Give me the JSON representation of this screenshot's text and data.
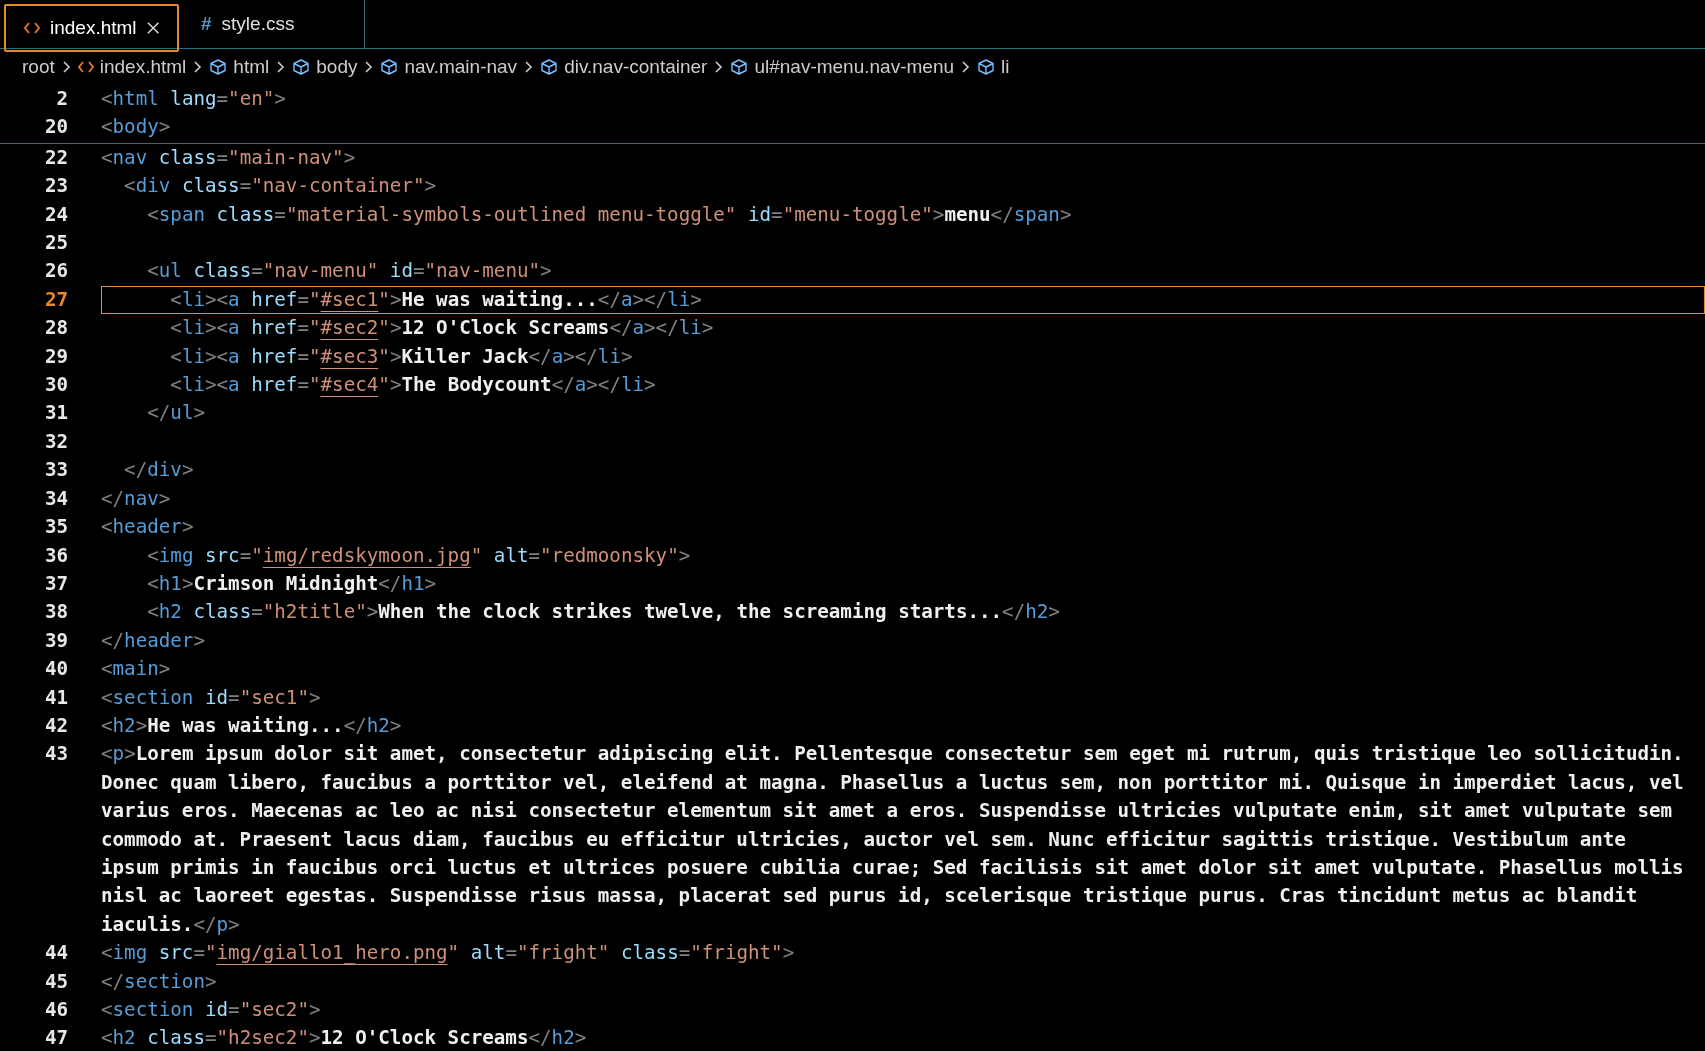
{
  "tabs": [
    {
      "label": "index.html",
      "kind": "html",
      "selected": true,
      "closable": true
    },
    {
      "label": "style.css",
      "kind": "css",
      "glyph": "#",
      "selected": false,
      "closable": false
    }
  ],
  "breadcrumb": [
    {
      "label": "root",
      "kind": "plain"
    },
    {
      "label": "index.html",
      "kind": "file"
    },
    {
      "label": "html",
      "kind": "symbol"
    },
    {
      "label": "body",
      "kind": "symbol"
    },
    {
      "label": "nav.main-nav",
      "kind": "symbol"
    },
    {
      "label": "div.nav-container",
      "kind": "symbol"
    },
    {
      "label": "ul#nav-menu.nav-menu",
      "kind": "symbol"
    },
    {
      "label": "li",
      "kind": "symbol"
    }
  ],
  "sticky_lines": [
    {
      "number": "2",
      "current": false,
      "tokens": [
        {
          "kind": "punct",
          "text": "<"
        },
        {
          "kind": "tag",
          "text": "html"
        },
        {
          "kind": "attr",
          "text": " lang"
        },
        {
          "kind": "punct",
          "text": "="
        },
        {
          "kind": "string",
          "text": "\"en\""
        },
        {
          "kind": "punct",
          "text": ">"
        }
      ]
    },
    {
      "number": "20",
      "current": false,
      "tokens": [
        {
          "kind": "punct",
          "text": "<"
        },
        {
          "kind": "tag",
          "text": "body"
        },
        {
          "kind": "punct",
          "text": ">"
        }
      ]
    }
  ],
  "lines": [
    {
      "number": "22",
      "current": false,
      "tokens": [
        {
          "kind": "punct",
          "text": "<"
        },
        {
          "kind": "tag",
          "text": "nav"
        },
        {
          "kind": "attr",
          "text": " class"
        },
        {
          "kind": "punct",
          "text": "="
        },
        {
          "kind": "string",
          "text": "\"main-nav\""
        },
        {
          "kind": "punct",
          "text": ">"
        }
      ]
    },
    {
      "number": "23",
      "current": false,
      "tokens": [
        {
          "kind": "punct",
          "text": "  <"
        },
        {
          "kind": "tag",
          "text": "div"
        },
        {
          "kind": "attr",
          "text": " class"
        },
        {
          "kind": "punct",
          "text": "="
        },
        {
          "kind": "string",
          "text": "\"nav-container\""
        },
        {
          "kind": "punct",
          "text": ">"
        }
      ]
    },
    {
      "number": "24",
      "current": false,
      "tokens": [
        {
          "kind": "punct",
          "text": "    <"
        },
        {
          "kind": "tag",
          "text": "span"
        },
        {
          "kind": "attr",
          "text": " class"
        },
        {
          "kind": "punct",
          "text": "="
        },
        {
          "kind": "string",
          "text": "\"material-symbols-outlined menu-toggle\""
        },
        {
          "kind": "attr",
          "text": " id"
        },
        {
          "kind": "punct",
          "text": "="
        },
        {
          "kind": "string",
          "text": "\"menu-toggle\""
        },
        {
          "kind": "punct",
          "text": ">"
        },
        {
          "kind": "text",
          "text": "menu"
        },
        {
          "kind": "punct",
          "text": "</"
        },
        {
          "kind": "tag",
          "text": "span"
        },
        {
          "kind": "punct",
          "text": ">"
        }
      ]
    },
    {
      "number": "25",
      "current": false
    },
    {
      "number": "26",
      "current": false,
      "tokens": [
        {
          "kind": "punct",
          "text": "    <"
        },
        {
          "kind": "tag",
          "text": "ul"
        },
        {
          "kind": "attr",
          "text": " class"
        },
        {
          "kind": "punct",
          "text": "="
        },
        {
          "kind": "string",
          "text": "\"nav-menu\""
        },
        {
          "kind": "attr",
          "text": " id"
        },
        {
          "kind": "punct",
          "text": "="
        },
        {
          "kind": "string",
          "text": "\"nav-menu\""
        },
        {
          "kind": "punct",
          "text": ">"
        }
      ]
    },
    {
      "number": "27",
      "current": true,
      "tokens": [
        {
          "kind": "punct",
          "text": "      <"
        },
        {
          "kind": "tag",
          "text": "li"
        },
        {
          "kind": "punct",
          "text": "><"
        },
        {
          "kind": "tag",
          "text": "a"
        },
        {
          "kind": "attr",
          "text": " href"
        },
        {
          "kind": "punct",
          "text": "="
        },
        {
          "kind": "string",
          "text": "\""
        },
        {
          "kind": "link",
          "text": "#sec1"
        },
        {
          "kind": "string",
          "text": "\""
        },
        {
          "kind": "punct",
          "text": ">"
        },
        {
          "kind": "text",
          "text": "He was waiting..."
        },
        {
          "kind": "punct",
          "text": "</"
        },
        {
          "kind": "tag",
          "text": "a"
        },
        {
          "kind": "punct",
          "text": "></"
        },
        {
          "kind": "tag",
          "text": "li"
        },
        {
          "kind": "punct",
          "text": ">"
        }
      ]
    },
    {
      "number": "28",
      "current": false,
      "tokens": [
        {
          "kind": "punct",
          "text": "      <"
        },
        {
          "kind": "tag",
          "text": "li"
        },
        {
          "kind": "punct",
          "text": "><"
        },
        {
          "kind": "tag",
          "text": "a"
        },
        {
          "kind": "attr",
          "text": " href"
        },
        {
          "kind": "punct",
          "text": "="
        },
        {
          "kind": "string",
          "text": "\""
        },
        {
          "kind": "link",
          "text": "#sec2"
        },
        {
          "kind": "string",
          "text": "\""
        },
        {
          "kind": "punct",
          "text": ">"
        },
        {
          "kind": "text",
          "text": "12 O'Clock Screams"
        },
        {
          "kind": "punct",
          "text": "</"
        },
        {
          "kind": "tag",
          "text": "a"
        },
        {
          "kind": "punct",
          "text": "></"
        },
        {
          "kind": "tag",
          "text": "li"
        },
        {
          "kind": "punct",
          "text": ">"
        }
      ]
    },
    {
      "number": "29",
      "current": false,
      "tokens": [
        {
          "kind": "punct",
          "text": "      <"
        },
        {
          "kind": "tag",
          "text": "li"
        },
        {
          "kind": "punct",
          "text": "><"
        },
        {
          "kind": "tag",
          "text": "a"
        },
        {
          "kind": "attr",
          "text": " href"
        },
        {
          "kind": "punct",
          "text": "="
        },
        {
          "kind": "string",
          "text": "\""
        },
        {
          "kind": "link",
          "text": "#sec3"
        },
        {
          "kind": "string",
          "text": "\""
        },
        {
          "kind": "punct",
          "text": ">"
        },
        {
          "kind": "text",
          "text": "Killer Jack"
        },
        {
          "kind": "punct",
          "text": "</"
        },
        {
          "kind": "tag",
          "text": "a"
        },
        {
          "kind": "punct",
          "text": "></"
        },
        {
          "kind": "tag",
          "text": "li"
        },
        {
          "kind": "punct",
          "text": ">"
        }
      ]
    },
    {
      "number": "30",
      "current": false,
      "tokens": [
        {
          "kind": "punct",
          "text": "      <"
        },
        {
          "kind": "tag",
          "text": "li"
        },
        {
          "kind": "punct",
          "text": "><"
        },
        {
          "kind": "tag",
          "text": "a"
        },
        {
          "kind": "attr",
          "text": " href"
        },
        {
          "kind": "punct",
          "text": "="
        },
        {
          "kind": "string",
          "text": "\""
        },
        {
          "kind": "link",
          "text": "#sec4"
        },
        {
          "kind": "string",
          "text": "\""
        },
        {
          "kind": "punct",
          "text": ">"
        },
        {
          "kind": "text",
          "text": "The Bodycount"
        },
        {
          "kind": "punct",
          "text": "</"
        },
        {
          "kind": "tag",
          "text": "a"
        },
        {
          "kind": "punct",
          "text": "></"
        },
        {
          "kind": "tag",
          "text": "li"
        },
        {
          "kind": "punct",
          "text": ">"
        }
      ]
    },
    {
      "number": "31",
      "current": false,
      "tokens": [
        {
          "kind": "punct",
          "text": "    </"
        },
        {
          "kind": "tag",
          "text": "ul"
        },
        {
          "kind": "punct",
          "text": ">"
        }
      ]
    },
    {
      "number": "32",
      "current": false
    },
    {
      "number": "33",
      "current": false,
      "tokens": [
        {
          "kind": "punct",
          "text": "  </"
        },
        {
          "kind": "tag",
          "text": "div"
        },
        {
          "kind": "punct",
          "text": ">"
        }
      ]
    },
    {
      "number": "34",
      "current": false,
      "tokens": [
        {
          "kind": "punct",
          "text": "</"
        },
        {
          "kind": "tag",
          "text": "nav"
        },
        {
          "kind": "punct",
          "text": ">"
        }
      ]
    },
    {
      "number": "35",
      "current": false,
      "tokens": [
        {
          "kind": "punct",
          "text": "<"
        },
        {
          "kind": "tag",
          "text": "header"
        },
        {
          "kind": "punct",
          "text": ">"
        }
      ]
    },
    {
      "number": "36",
      "current": false,
      "tokens": [
        {
          "kind": "punct",
          "text": "    <"
        },
        {
          "kind": "tag",
          "text": "img"
        },
        {
          "kind": "attr",
          "text": " src"
        },
        {
          "kind": "punct",
          "text": "="
        },
        {
          "kind": "string",
          "text": "\""
        },
        {
          "kind": "link",
          "text": "img/redskymoon.jpg"
        },
        {
          "kind": "string",
          "text": "\""
        },
        {
          "kind": "attr",
          "text": " alt"
        },
        {
          "kind": "punct",
          "text": "="
        },
        {
          "kind": "string",
          "text": "\"redmoonsky\""
        },
        {
          "kind": "punct",
          "text": ">"
        }
      ]
    },
    {
      "number": "37",
      "current": false,
      "tokens": [
        {
          "kind": "punct",
          "text": "    <"
        },
        {
          "kind": "tag",
          "text": "h1"
        },
        {
          "kind": "punct",
          "text": ">"
        },
        {
          "kind": "text",
          "text": "Crimson Midnight"
        },
        {
          "kind": "punct",
          "text": "</"
        },
        {
          "kind": "tag",
          "text": "h1"
        },
        {
          "kind": "punct",
          "text": ">"
        }
      ]
    },
    {
      "number": "38",
      "current": false,
      "tokens": [
        {
          "kind": "punct",
          "text": "    <"
        },
        {
          "kind": "tag",
          "text": "h2"
        },
        {
          "kind": "attr",
          "text": " class"
        },
        {
          "kind": "punct",
          "text": "="
        },
        {
          "kind": "string",
          "text": "\"h2title\""
        },
        {
          "kind": "punct",
          "text": ">"
        },
        {
          "kind": "text",
          "text": "When the clock strikes twelve, the screaming starts..."
        },
        {
          "kind": "punct",
          "text": "</"
        },
        {
          "kind": "tag",
          "text": "h2"
        },
        {
          "kind": "punct",
          "text": ">"
        }
      ]
    },
    {
      "number": "39",
      "current": false,
      "tokens": [
        {
          "kind": "punct",
          "text": "</"
        },
        {
          "kind": "tag",
          "text": "header"
        },
        {
          "kind": "punct",
          "text": ">"
        }
      ]
    },
    {
      "number": "40",
      "current": false,
      "tokens": [
        {
          "kind": "punct",
          "text": "<"
        },
        {
          "kind": "tag",
          "text": "main"
        },
        {
          "kind": "punct",
          "text": ">"
        }
      ]
    },
    {
      "number": "41",
      "current": false,
      "tokens": [
        {
          "kind": "punct",
          "text": "<"
        },
        {
          "kind": "tag",
          "text": "section"
        },
        {
          "kind": "attr",
          "text": " id"
        },
        {
          "kind": "punct",
          "text": "="
        },
        {
          "kind": "string",
          "text": "\"sec1\""
        },
        {
          "kind": "punct",
          "text": ">"
        }
      ]
    },
    {
      "number": "42",
      "current": false,
      "tokens": [
        {
          "kind": "punct",
          "text": "<"
        },
        {
          "kind": "tag",
          "text": "h2"
        },
        {
          "kind": "punct",
          "text": ">"
        },
        {
          "kind": "text",
          "text": "He was waiting..."
        },
        {
          "kind": "punct",
          "text": "</"
        },
        {
          "kind": "tag",
          "text": "h2"
        },
        {
          "kind": "punct",
          "text": ">"
        }
      ]
    },
    {
      "number": "43",
      "current": false,
      "tokens": [
        {
          "kind": "punct",
          "text": "<"
        },
        {
          "kind": "tag",
          "text": "p"
        },
        {
          "kind": "punct",
          "text": ">"
        },
        {
          "kind": "text",
          "text": "Lorem ipsum dolor sit amet, consectetur adipiscing elit. Pellentesque consectetur sem eget mi rutrum, quis tristique leo sollicitudin. Donec quam libero, faucibus a porttitor vel, eleifend at magna. Phasellus a luctus sem, non porttitor mi. Quisque in imperdiet lacus, vel varius eros. Maecenas ac leo ac nisi consectetur elementum sit amet a eros. Suspendisse ultricies vulputate enim, sit amet vulputate sem commodo at. Praesent lacus diam, faucibus eu efficitur ultricies, auctor vel sem. Nunc efficitur sagittis tristique. Vestibulum ante ipsum primis in faucibus orci luctus et ultrices posuere cubilia curae; Sed facilisis sit amet dolor sit amet vulputate. Phasellus mollis nisl ac laoreet egestas. Suspendisse risus massa, placerat sed purus id, scelerisque tristique purus. Cras tincidunt metus ac blandit iaculis."
        },
        {
          "kind": "punct",
          "text": "</"
        },
        {
          "kind": "tag",
          "text": "p"
        },
        {
          "kind": "punct",
          "text": ">"
        }
      ]
    },
    {
      "number": "44",
      "current": false,
      "tokens": [
        {
          "kind": "punct",
          "text": "<"
        },
        {
          "kind": "tag",
          "text": "img"
        },
        {
          "kind": "attr",
          "text": " src"
        },
        {
          "kind": "punct",
          "text": "="
        },
        {
          "kind": "string",
          "text": "\""
        },
        {
          "kind": "link",
          "text": "img/giallo1_hero.png"
        },
        {
          "kind": "string",
          "text": "\""
        },
        {
          "kind": "attr",
          "text": " alt"
        },
        {
          "kind": "punct",
          "text": "="
        },
        {
          "kind": "string",
          "text": "\"fright\""
        },
        {
          "kind": "attr",
          "text": " class"
        },
        {
          "kind": "punct",
          "text": "="
        },
        {
          "kind": "string",
          "text": "\"fright\""
        },
        {
          "kind": "punct",
          "text": ">"
        }
      ]
    },
    {
      "number": "45",
      "current": false,
      "tokens": [
        {
          "kind": "punct",
          "text": "</"
        },
        {
          "kind": "tag",
          "text": "section"
        },
        {
          "kind": "punct",
          "text": ">"
        }
      ]
    },
    {
      "number": "46",
      "current": false,
      "tokens": [
        {
          "kind": "punct",
          "text": "<"
        },
        {
          "kind": "tag",
          "text": "section"
        },
        {
          "kind": "attr",
          "text": " id"
        },
        {
          "kind": "punct",
          "text": "="
        },
        {
          "kind": "string",
          "text": "\"sec2\""
        },
        {
          "kind": "punct",
          "text": ">"
        }
      ]
    },
    {
      "number": "47",
      "current": false,
      "tokens": [
        {
          "kind": "punct",
          "text": "<"
        },
        {
          "kind": "tag",
          "text": "h2"
        },
        {
          "kind": "attr",
          "text": " class"
        },
        {
          "kind": "punct",
          "text": "="
        },
        {
          "kind": "string",
          "text": "\"h2sec2\""
        },
        {
          "kind": "punct",
          "text": ">"
        },
        {
          "kind": "text",
          "text": "12 O'Clock Screams"
        },
        {
          "kind": "punct",
          "text": "</"
        },
        {
          "kind": "tag",
          "text": "h2"
        },
        {
          "kind": "punct",
          "text": ">"
        }
      ]
    }
  ]
}
